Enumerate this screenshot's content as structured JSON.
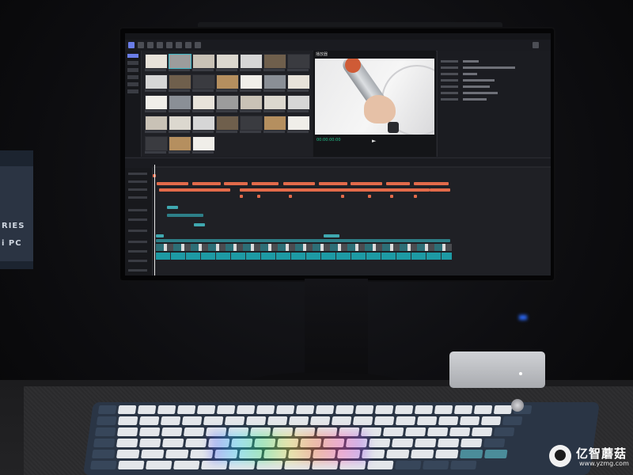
{
  "scene": {
    "description_labels": {
      "wall_poster_text": [
        "RIES",
        "i PC"
      ]
    }
  },
  "app": {
    "brand": "",
    "viewer_title": "播放器",
    "timecode": "00:00:00:00",
    "play_glyph": "►"
  },
  "watermark": {
    "name": "亿智蘑菇",
    "url": "www.yzmg.com"
  },
  "colors": {
    "accent_teal": "#3fb7c6",
    "clip_orange": "#e26a4a",
    "clip_teal": "#3fa8b0",
    "timecode_green": "#23c28a",
    "pc_led_blue": "#2c6bff"
  },
  "icons": [
    "play-icon",
    "logo-icon"
  ]
}
